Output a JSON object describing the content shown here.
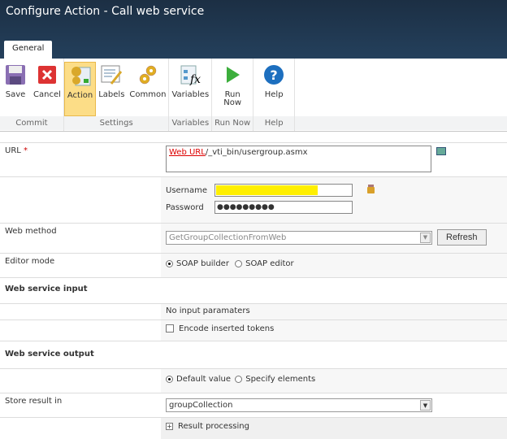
{
  "window": {
    "title": "Configure Action - Call web service",
    "tab": "General"
  },
  "ribbon": {
    "groups": [
      {
        "label": "Commit"
      },
      {
        "label": "Settings"
      },
      {
        "label": "Variables"
      },
      {
        "label": "Run Now"
      },
      {
        "label": "Help"
      }
    ],
    "buttons": {
      "save": "Save",
      "cancel": "Cancel",
      "action": "Action",
      "labels": "Labels",
      "common": "Common",
      "variables": "Variables",
      "run_now_1": "Run",
      "run_now_2": "Now",
      "help": "Help"
    }
  },
  "form": {
    "url": {
      "label": "URL",
      "required": "*",
      "token": "Web URL",
      "value": "/_vti_bin/usergroup.asmx"
    },
    "username": {
      "label": "Username",
      "value": ""
    },
    "password": {
      "label": "Password",
      "value": "●●●●●●●●●"
    },
    "web_method": {
      "label": "Web method",
      "value": "GetGroupCollectionFromWeb",
      "refresh": "Refresh"
    },
    "editor_mode": {
      "label": "Editor mode",
      "options": [
        "SOAP builder",
        "SOAP editor"
      ],
      "selected": "SOAP builder"
    },
    "input_heading": "Web service input",
    "no_input": "No input paramaters",
    "encode": "Encode inserted tokens",
    "output_heading": "Web service output",
    "output_options": [
      "Default value",
      "Specify elements"
    ],
    "store": {
      "label": "Store result in",
      "value": "groupCollection"
    },
    "result_processing": "Result processing"
  }
}
